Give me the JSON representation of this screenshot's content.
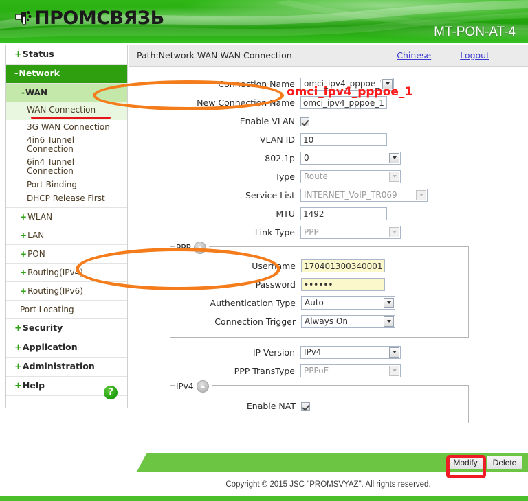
{
  "header": {
    "brand": "ПРОМСВЯЗЬ",
    "logo_icon": "plug-connector-icon",
    "model": "MT-PON-AT-4"
  },
  "sidebar": {
    "items": [
      {
        "label": "Status",
        "prefix": "+",
        "level": "top",
        "active": false
      },
      {
        "label": "Network",
        "prefix": "-",
        "level": "top",
        "active": true
      },
      {
        "label": "WAN",
        "prefix": "-",
        "level": "sub",
        "active": false
      },
      {
        "label": "WAN Connection",
        "prefix": "",
        "level": "sub2",
        "active": true
      },
      {
        "label": "3G WAN Connection",
        "prefix": "",
        "level": "leaf",
        "active": false
      },
      {
        "label": "4in6 Tunnel Connection",
        "prefix": "",
        "level": "leaf",
        "active": false
      },
      {
        "label": "6in4 Tunnel Connection",
        "prefix": "",
        "level": "leaf",
        "active": false
      },
      {
        "label": "Port Binding",
        "prefix": "",
        "level": "leaf",
        "active": false
      },
      {
        "label": "DHCP Release First",
        "prefix": "",
        "level": "leaf",
        "active": false
      },
      {
        "label": "WLAN",
        "prefix": "+",
        "level": "group",
        "active": false
      },
      {
        "label": "LAN",
        "prefix": "+",
        "level": "group",
        "active": false
      },
      {
        "label": "PON",
        "prefix": "+",
        "level": "group",
        "active": false
      },
      {
        "label": "Routing(IPv4)",
        "prefix": "+",
        "level": "group",
        "active": false
      },
      {
        "label": "Routing(IPv6)",
        "prefix": "+",
        "level": "group",
        "active": false
      },
      {
        "label": "Port Locating",
        "prefix": "",
        "level": "group-plain",
        "active": false
      },
      {
        "label": "Security",
        "prefix": "+",
        "level": "top",
        "active": false
      },
      {
        "label": "Application",
        "prefix": "+",
        "level": "top",
        "active": false
      },
      {
        "label": "Administration",
        "prefix": "+",
        "level": "top",
        "active": false
      },
      {
        "label": "Help",
        "prefix": "+",
        "level": "top",
        "active": false
      }
    ],
    "help_button": "?"
  },
  "pathbar": {
    "path": "Path:Network-WAN-WAN Connection",
    "chinese_link": "Chinese",
    "logout_link": "Logout"
  },
  "form": {
    "connection_name_label": "Connection Name",
    "connection_name_value": "omci_ipv4_pppoe_1",
    "new_connection_name_label": "New Connection Name",
    "new_connection_name_value": "omci_ipv4_pppoe_1",
    "enable_vlan_label": "Enable VLAN",
    "enable_vlan_checked": true,
    "vlan_id_label": "VLAN ID",
    "vlan_id_value": "10",
    "dot1p_label": "802.1p",
    "dot1p_value": "0",
    "type_label": "Type",
    "type_value": "Route",
    "service_list_label": "Service List",
    "service_list_value": "INTERNET_VoIP_TR069",
    "mtu_label": "MTU",
    "mtu_value": "1492",
    "link_type_label": "Link Type",
    "link_type_value": "PPP",
    "ip_version_label": "IP Version",
    "ip_version_value": "IPv4",
    "ppp_transtype_label": "PPP TransType",
    "ppp_transtype_value": "PPPoE"
  },
  "ppp_panel": {
    "legend": "PPP",
    "username_label": "Username",
    "username_value": "170401300340001",
    "password_label": "Password",
    "password_value": "••••••",
    "auth_type_label": "Authentication Type",
    "auth_type_value": "Auto",
    "trigger_label": "Connection Trigger",
    "trigger_value": "Always On"
  },
  "ipv4_panel": {
    "legend": "IPv4",
    "enable_nat_label": "Enable NAT",
    "enable_nat_checked": true
  },
  "annotations": {
    "connection_name_callout": "omci_ipv4_pppoe_1",
    "highlight_color": "#f47c1b",
    "callout_color": "#fb1c1c"
  },
  "footer": {
    "modify_button": "Modify",
    "delete_button": "Delete",
    "copyright": "Copyright © 2015 JSC \"PROMSVYAZ\". All rights reserved."
  }
}
